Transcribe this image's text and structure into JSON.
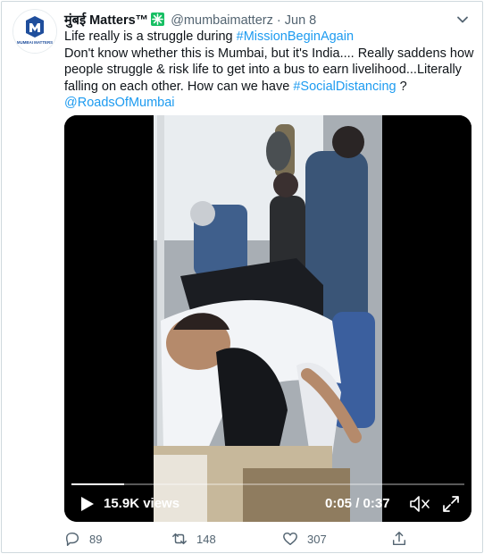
{
  "tweet": {
    "author_name": "मुंबई Matters™",
    "handle": "@mumbaimatterz",
    "separator": "·",
    "date": "Jun 8",
    "avatar_text": "MUMBAI MATTERS",
    "body": {
      "line1_prefix": "Life really is a struggle during ",
      "hashtag1": "#MissionBeginAgain",
      "line2": "Don't know whether this is Mumbai, but it's India.... Really saddens how people struggle & risk life to get into a bus to earn livelihood...Literally falling on each other. How can we have ",
      "hashtag2": "#SocialDistancing",
      "line2_suffix": " ?",
      "mention": "@RoadsOfMumbai"
    },
    "video": {
      "views": "15.9K views",
      "time": "0:05 / 0:37",
      "progress": 0.135
    },
    "actions": {
      "replies": "89",
      "retweets": "148",
      "likes": "307"
    },
    "colors": {
      "link": "#1d9bf0",
      "badge": "#17bf63",
      "avatar_brand": "#1f4e9c"
    },
    "icons": {
      "badge": "green-sparkle-icon",
      "more": "chevron-down-icon",
      "play": "play-icon",
      "mute": "speaker-muted-icon",
      "fullscreen": "fullscreen-icon",
      "reply": "reply-icon",
      "retweet": "retweet-icon",
      "like": "heart-icon",
      "share": "share-icon"
    }
  }
}
